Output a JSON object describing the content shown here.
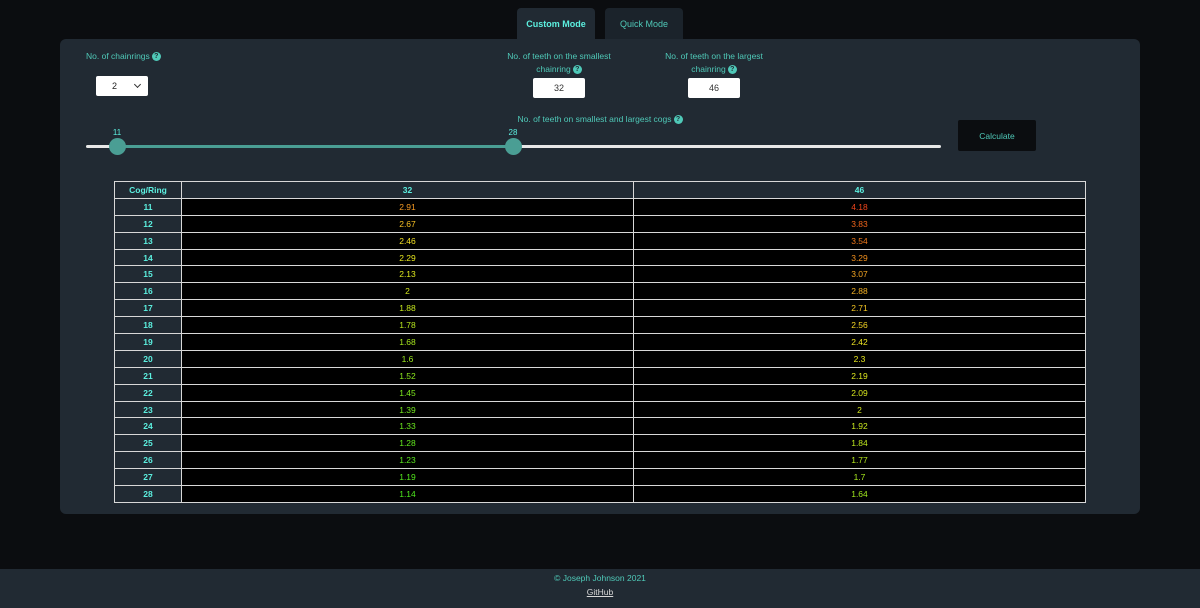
{
  "tabs": [
    {
      "label": "Custom Mode",
      "active": true
    },
    {
      "label": "Quick Mode",
      "active": false
    }
  ],
  "form": {
    "chainrings_label": "No. of chainrings",
    "chainrings_value": "2",
    "smallest_label_line1": "No. of teeth on the smallest",
    "smallest_label_line2": "chainring",
    "smallest_value": "32",
    "largest_label_line1": "No. of teeth on the largest",
    "largest_label_line2": "chainring",
    "largest_value": "46",
    "cogs_label": "No. of teeth on smallest and largest cogs",
    "cog_min": "11",
    "cog_max": "28",
    "calculate_label": "Calculate"
  },
  "table": {
    "headers": [
      "Cog/Ring",
      "32",
      "46"
    ],
    "rows": [
      {
        "cog": "11",
        "r1": "2.91",
        "r2": "4.18",
        "c1": "#f59a23",
        "c2": "#f2461c"
      },
      {
        "cog": "12",
        "r1": "2.67",
        "r2": "3.83",
        "c1": "#f7c023",
        "c2": "#f2661c"
      },
      {
        "cog": "13",
        "r1": "2.46",
        "r2": "3.54",
        "c1": "#f5e223",
        "c2": "#f27a1c"
      },
      {
        "cog": "14",
        "r1": "2.29",
        "r2": "3.29",
        "c1": "#e8e81e",
        "c2": "#f5921e"
      },
      {
        "cog": "15",
        "r1": "2.13",
        "r2": "3.07",
        "c1": "#dfe81e",
        "c2": "#f5a623"
      },
      {
        "cog": "16",
        "r1": "2",
        "r2": "2.88",
        "c1": "#d4e81e",
        "c2": "#f5b223"
      },
      {
        "cog": "17",
        "r1": "1.88",
        "r2": "2.71",
        "c1": "#c6e81e",
        "c2": "#f5c623"
      },
      {
        "cog": "18",
        "r1": "1.78",
        "r2": "2.56",
        "c1": "#b8e81e",
        "c2": "#f5d623"
      },
      {
        "cog": "19",
        "r1": "1.68",
        "r2": "2.42",
        "c1": "#a8e81e",
        "c2": "#f0e623"
      },
      {
        "cog": "20",
        "r1": "1.6",
        "r2": "2.3",
        "c1": "#9ae81e",
        "c2": "#e8e81e"
      },
      {
        "cog": "21",
        "r1": "1.52",
        "r2": "2.19",
        "c1": "#8ce81e",
        "c2": "#dfe81e"
      },
      {
        "cog": "22",
        "r1": "1.45",
        "r2": "2.09",
        "c1": "#7ee81e",
        "c2": "#d8e81e"
      },
      {
        "cog": "23",
        "r1": "1.39",
        "r2": "2",
        "c1": "#74e81e",
        "c2": "#d4e81e"
      },
      {
        "cog": "24",
        "r1": "1.33",
        "r2": "1.92",
        "c1": "#6ae81e",
        "c2": "#c9e81e"
      },
      {
        "cog": "25",
        "r1": "1.28",
        "r2": "1.84",
        "c1": "#62e81e",
        "c2": "#bee81e"
      },
      {
        "cog": "26",
        "r1": "1.23",
        "r2": "1.77",
        "c1": "#5ae81e",
        "c2": "#b4e81e"
      },
      {
        "cog": "27",
        "r1": "1.19",
        "r2": "1.7",
        "c1": "#54e81e",
        "c2": "#a8e81e"
      },
      {
        "cog": "28",
        "r1": "1.14",
        "r2": "1.64",
        "c1": "#4ee81e",
        "c2": "#a0e81e"
      }
    ]
  },
  "footer": {
    "copyright": "© Joseph Johnson 2021",
    "github_label": "GitHub"
  }
}
